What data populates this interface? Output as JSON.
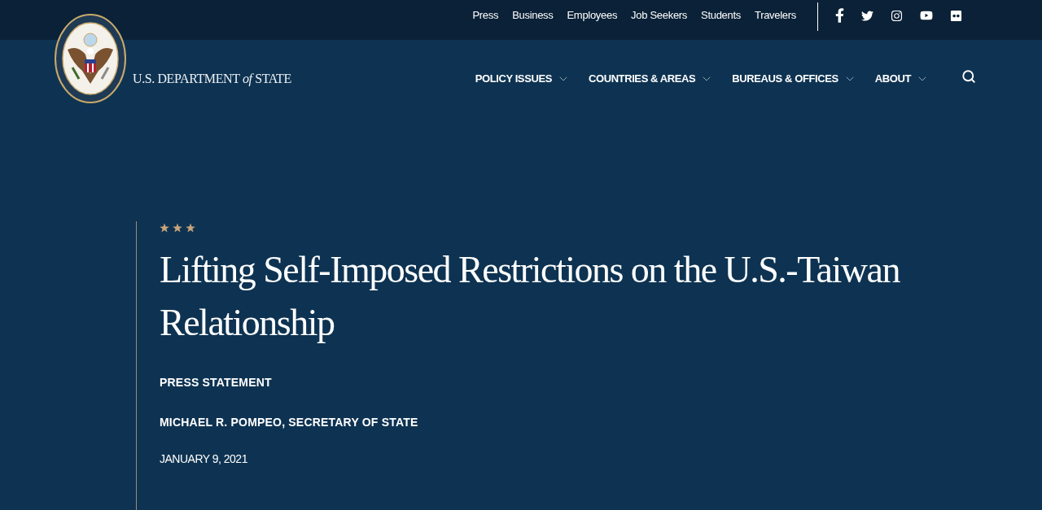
{
  "utility_nav": {
    "links": [
      "Press",
      "Business",
      "Employees",
      "Job Seekers",
      "Students",
      "Travelers"
    ]
  },
  "header": {
    "logo_text": "U.S. DEPARTMENT *of* STATE",
    "nav": [
      {
        "label": "POLICY ISSUES"
      },
      {
        "label": "COUNTRIES & AREAS"
      },
      {
        "label": "BUREAUS & OFFICES"
      },
      {
        "label": "ABOUT"
      }
    ]
  },
  "article": {
    "title": "Lifting Self-Imposed Restrictions on the U.S.-Taiwan Relationship",
    "type": "PRESS STATEMENT",
    "author": "MICHAEL R. POMPEO, SECRETARY OF STATE",
    "date": "JANUARY 9, 2021"
  }
}
